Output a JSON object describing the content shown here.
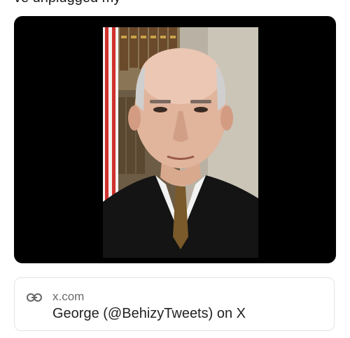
{
  "header": {
    "partial_text": "ve unplugged my"
  },
  "media": {
    "image_alt_icon": "portrait-photo"
  },
  "link_card": {
    "icon": "link-icon",
    "domain": "x.com",
    "title": "George (@BehizyTweets) on X"
  }
}
